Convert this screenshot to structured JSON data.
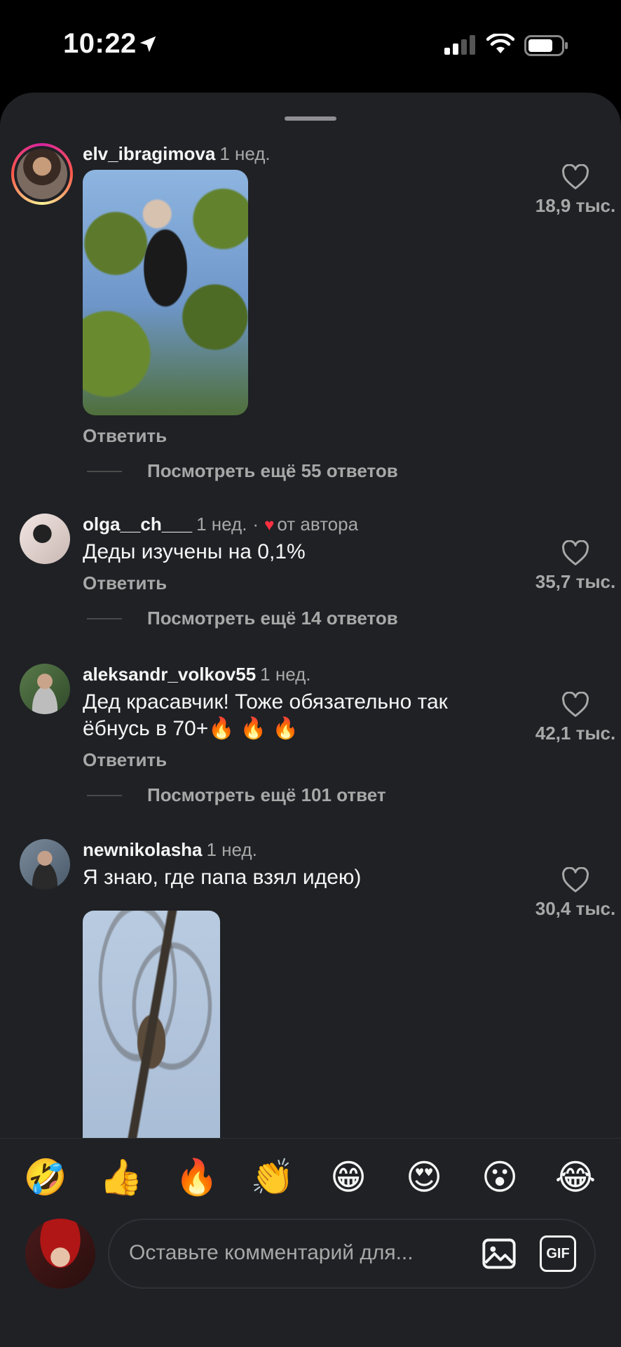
{
  "status_bar": {
    "time": "10:22"
  },
  "comments": [
    {
      "username": "elv_ibragimova",
      "time_ago": "1 нед.",
      "reply_label": "Ответить",
      "likes": "18,9 тыс.",
      "view_more": "Посмотреть ещё 55 ответов"
    },
    {
      "username": "olga__ch___",
      "time_ago": "1 нед.",
      "separator": "·",
      "author_heart": "♥",
      "author_label": "от автора",
      "text": "Деды изучены на 0,1%",
      "reply_label": "Ответить",
      "likes": "35,7 тыс.",
      "view_more": "Посмотреть ещё 14 ответов"
    },
    {
      "username": "aleksandr_volkov55",
      "time_ago": "1 нед.",
      "text_line1": "Дед красавчик! Тоже обязательно так",
      "text_line2": "ёбнусь в 70+🔥 🔥 🔥",
      "reply_label": "Ответить",
      "likes": "42,1 тыс.",
      "view_more": "Посмотреть ещё 101 ответ"
    },
    {
      "username": "newnikolasha",
      "time_ago": "1 нед.",
      "text": "Я знаю, где папа взял идею)",
      "likes": "30,4 тыс."
    }
  ],
  "emoji_bar": [
    "🤣",
    "👍",
    "🔥",
    "👏",
    "😁",
    "😍",
    "😮",
    "😂"
  ],
  "composer": {
    "placeholder": "Оставьте комментарий для...",
    "gif_label": "GIF"
  },
  "colors": {
    "background": "#000000",
    "sheet": "#1f2125",
    "secondary_text": "#a8a8a8",
    "author_heart": "#ff3040"
  },
  "icons": [
    "location-arrow-icon",
    "signal-icon",
    "wifi-icon",
    "battery-icon",
    "heart-icon",
    "image-icon",
    "gif-icon"
  ]
}
